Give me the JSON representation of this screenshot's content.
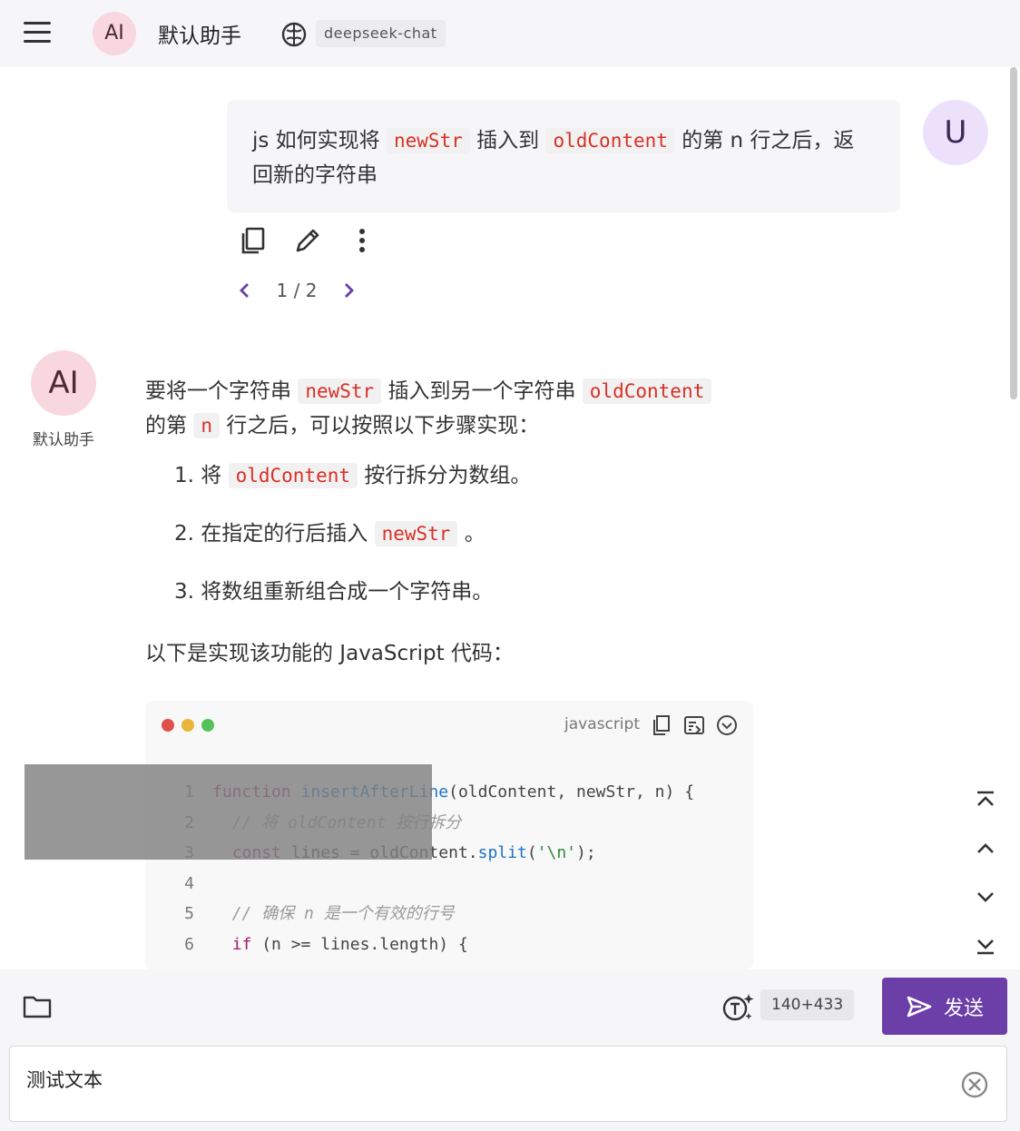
{
  "header": {
    "avatar_text": "AI",
    "assistant_name": "默认助手",
    "model": "deepseek-chat"
  },
  "user_message": {
    "avatar_text": "U",
    "text_1": "js 如何实现将 ",
    "code_1": "newStr",
    "text_2": " 插入到 ",
    "code_2": "oldContent",
    "text_3": " 的第 n 行之后，返回新的字符串",
    "pager": "1 / 2"
  },
  "assistant_message": {
    "avatar_text": "AI",
    "name": "默认助手",
    "p1_text_1": "要将一个字符串 ",
    "p1_code_1": "newStr",
    "p1_text_2": " 插入到另一个字符串 ",
    "p1_code_2": "oldContent",
    "p1_text_3": " 的第 ",
    "p1_code_3": "n",
    "p1_text_4": " 行之后，可以按照以下步骤实现：",
    "steps": [
      {
        "num": "1. ",
        "pre": "将 ",
        "code": "oldContent",
        "post": " 按行拆分为数组。"
      },
      {
        "num": "2. ",
        "pre": "在指定的行后插入 ",
        "code": "newStr",
        "post": " 。"
      },
      {
        "num": "3. ",
        "pre": "将数组重新组合成一个字符串。",
        "code": "",
        "post": ""
      }
    ],
    "p2": "以下是实现该功能的 JavaScript 代码："
  },
  "code_block": {
    "language": "javascript",
    "dot_colors": [
      "#e0504a",
      "#e9b63a",
      "#55c15a"
    ],
    "lines": [
      {
        "n": "1",
        "tokens": [
          [
            "kw",
            "function"
          ],
          [
            "pl",
            " "
          ],
          [
            "fn",
            "insertAfterLine"
          ],
          [
            "pl",
            "(oldContent, newStr, n) {"
          ]
        ]
      },
      {
        "n": "2",
        "tokens": [
          [
            "pl",
            "  "
          ],
          [
            "cm",
            "// 将 oldContent 按行拆分"
          ]
        ]
      },
      {
        "n": "3",
        "tokens": [
          [
            "pl",
            "  "
          ],
          [
            "kw",
            "const"
          ],
          [
            "pl",
            " lines = oldContent."
          ],
          [
            "fn",
            "split"
          ],
          [
            "pl",
            "("
          ],
          [
            "str",
            "'\\n'"
          ],
          [
            "pl",
            ");"
          ]
        ]
      },
      {
        "n": "4",
        "tokens": []
      },
      {
        "n": "5",
        "tokens": [
          [
            "pl",
            "  "
          ],
          [
            "cm",
            "// 确保 n 是一个有效的行号"
          ]
        ]
      },
      {
        "n": "6",
        "tokens": [
          [
            "pl",
            "  "
          ],
          [
            "kw",
            "if"
          ],
          [
            "pl",
            " (n >= lines.length) {"
          ]
        ]
      }
    ]
  },
  "composer": {
    "token_count": "140+433",
    "send_label": "发送",
    "input_value": "测试文本"
  }
}
